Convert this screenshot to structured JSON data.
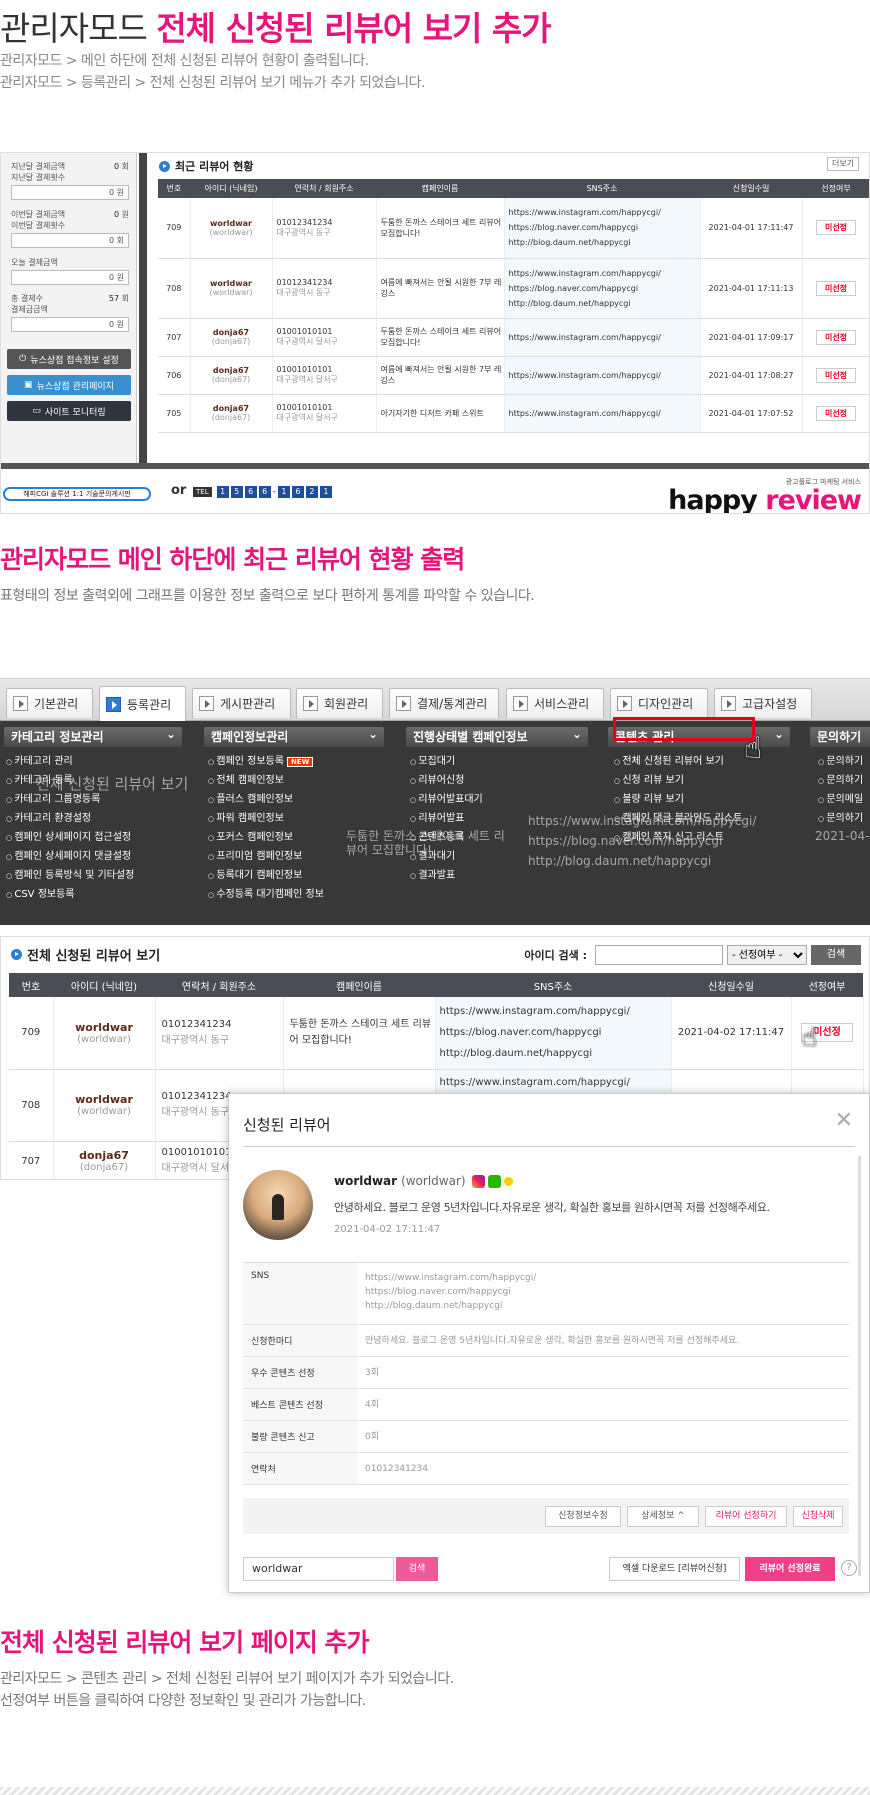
{
  "header": {
    "title_plain": "관리자모드",
    "title_highlight": "전체 신청된 리뷰어 보기 추가",
    "desc1": "관리자모드 > 메인 하단에 전체 신청된 리뷰어 현황이 출력됩니다.",
    "desc2": "관리자모드 > 등록관리 > 전체 신청된 리뷰어 보기 메뉴가 추가 되었습니다."
  },
  "shot1": {
    "stats": [
      {
        "label1": "지난달 결제금액",
        "val1": "0",
        "unit1": "회",
        "label2": "지난달 결제횟수",
        "box": "0",
        "boxunit": "원"
      },
      {
        "label1": "이번달 결제금액",
        "val1": "0",
        "unit1": "원",
        "label2": "이번달 결제횟수",
        "box": "0",
        "boxunit": "회"
      },
      {
        "label1": "오늘 결제금액",
        "val1": "",
        "unit1": "",
        "label2": "",
        "box": "0",
        "boxunit": "원"
      },
      {
        "label1": "총 결제수",
        "val1": "57",
        "unit1": "회",
        "label2": "결제금금액",
        "box": "0",
        "boxunit": "원"
      }
    ],
    "buttons": [
      "뉴스상점 접속정보 설정",
      "뉴스상점 관리페이지",
      "사이트 모니터링"
    ],
    "panel_title": "최근 리뷰어 현황",
    "more_label": "더보기",
    "columns": [
      "번호",
      "아이디 (닉네임)",
      "연락처 / 회원주소",
      "캠페인이름",
      "SNS주소",
      "신청일수일",
      "선정여부"
    ],
    "rows": [
      {
        "no": "709",
        "id": "worldwar",
        "nick": "(worldwar)",
        "phone": "01012341234",
        "addr": "대구광역시 동구",
        "campaign": "두툼한 돈까스 스테이크 세트 리뷰어 모집합니다!",
        "sns": [
          "https://www.instagram.com/happycgi/",
          "https://blog.naver.com/happycgi",
          "http://blog.daum.net/happycgi"
        ],
        "date": "2021-04-01 17:11:47",
        "status": "미선정"
      },
      {
        "no": "708",
        "id": "worldwar",
        "nick": "(worldwar)",
        "phone": "01012341234",
        "addr": "대구광역시 동구",
        "campaign": "여름에 빠져서는 안될 시원한 7부 레깅스",
        "sns": [
          "https://www.instagram.com/happycgi/",
          "https://blog.naver.com/happycgi",
          "http://blog.daum.net/happycgi"
        ],
        "date": "2021-04-01 17:11:13",
        "status": "미선정"
      },
      {
        "no": "707",
        "id": "donja67",
        "nick": "(donja67)",
        "phone": "01001010101",
        "addr": "대구광역시 달서구",
        "campaign": "두툼한 돈까스 스테이크 세트 리뷰어 모집합니다!",
        "sns": [
          "https://www.instagram.com/happycgi/"
        ],
        "date": "2021-04-01 17:09:17",
        "status": "미선정"
      },
      {
        "no": "706",
        "id": "donja67",
        "nick": "(donja67)",
        "phone": "01001010101",
        "addr": "대구광역시 달서구",
        "campaign": "여름에 빠져서는 안될 시원한 7부 레깅스",
        "sns": [
          "https://www.instagram.com/happycgi/"
        ],
        "date": "2021-04-01 17:08:27",
        "status": "미선정"
      },
      {
        "no": "705",
        "id": "donja67",
        "nick": "(donja67)",
        "phone": "01001010101",
        "addr": "대구광역시 달서구",
        "campaign": "아기자기한 디저트 카페 스위트",
        "sns": [
          "https://www.instagram.com/happycgi/"
        ],
        "date": "2021-04-01 17:07:52",
        "status": "미선정"
      }
    ],
    "footer": {
      "cgi_label": "해피CGI 솔루션 1:1 기술문의게시판",
      "or_label": "or",
      "tel_tag": "TEL",
      "tel_digits": [
        "1",
        "5",
        "6",
        "6",
        "-",
        "1",
        "6",
        "2",
        "1"
      ],
      "logo_small": "광고플로그 마케팅 서비스",
      "logo_happy": "happy",
      "logo_review": "review"
    }
  },
  "section2": {
    "title": "관리자모드 메인 하단에 최근 리뷰어 현황 출력",
    "desc": "표형태의 정보 출력외에 그래프를 이용한 정보 출력으로 보다 편하게 통계를 파악할 수 있습니다."
  },
  "shot2": {
    "tabs": [
      "기본관리",
      "등록관리",
      "게시판관리",
      "회원관리",
      "결제/통계관리",
      "서비스관리",
      "디자인관리",
      "고급자설정"
    ],
    "columns": [
      {
        "title": "카테고리 정보관리",
        "items": [
          "카테고리 관리",
          "카테고리 등록",
          "카테고리 그룹명등록",
          "카테고리 환경설정",
          "캠페인 상세페이지 접근설정",
          "캠페인 상세페이지 댓글설정",
          "캠페인 등록방식 및 기타설정",
          "CSV 정보등록"
        ]
      },
      {
        "title": "캠페인정보관리",
        "items": [
          "캠페인 정보등록",
          "전체 캠페인정보",
          "플러스 캠페인정보",
          "파워 캠페인정보",
          "포커스 캠페인정보",
          "프리미엄 캠페인정보",
          "등록대기 캠페인정보",
          "수정등록 대기캠페인 정보"
        ]
      },
      {
        "title": "진행상태별 캠페인정보",
        "items": [
          "모집대기",
          "리뷰어신청",
          "리뷰어발표대기",
          "리뷰어발표",
          "콘텐츠등록",
          "결과대기",
          "결과발표"
        ]
      },
      {
        "title": "콘텐츠 관리",
        "items": [
          "전체 신청된 리뷰어 보기",
          "신청 리뷰 보기",
          "불량 리뷰 보기",
          "캠페인 댓글 블라인드 리스트",
          "캠페인 쪽지 신고 리스트"
        ]
      },
      {
        "title": "문의하기",
        "items": [
          "문의하기",
          "문의하기",
          "문의메일",
          "문의하기"
        ]
      }
    ],
    "new_badge": "NEW"
  },
  "shot3": {
    "title": "전체 신청된 리뷰어 보기",
    "search_label": "아이디 검색 :",
    "select_value": "- 선정여부 -",
    "search_btn": "검색",
    "columns": [
      "번호",
      "아이디 (닉네임)",
      "연락처 / 회원주소",
      "캠페인이름",
      "SNS주소",
      "신청일수일",
      "선정여부"
    ],
    "rows": [
      {
        "no": "709",
        "id": "worldwar",
        "nick": "(worldwar)",
        "phone": "01012341234",
        "addr": "대구광역시 동구",
        "campaign": "두툼한 돈까스 스테이크 세트 리뷰어 모집합니다!",
        "sns": [
          "https://www.instagram.com/happycgi/",
          "https://blog.naver.com/happycgi",
          "http://blog.daum.net/happycgi"
        ],
        "date": "2021-04-02 17:11:47",
        "status": "미선정"
      },
      {
        "no": "708",
        "id": "worldwar",
        "nick": "(worldwar)",
        "phone": "01012341234",
        "addr": "대구광역시 동구",
        "campaign": "",
        "sns": [
          "https://www.instagram.com/happycgi/"
        ],
        "date": "",
        "status": ""
      },
      {
        "no": "707",
        "id": "donja67",
        "nick": "(donja67)",
        "phone": "01001010101",
        "addr": "대구광역시 달서구",
        "campaign": "",
        "sns": [],
        "date": "",
        "status": ""
      }
    ]
  },
  "modal": {
    "title": "신청된 리뷰어",
    "user_id": "worldwar",
    "user_nick": "(worldwar)",
    "intro": "안녕하세요. 블로그 운영 5년차입니다.자유로운 생각, 확실한 홍보를 원하시면꼭 저를 선정해주세요.",
    "date": "2021-04-02 17:11:47",
    "fields": [
      {
        "key": "SNS",
        "values": [
          "https://www.instagram.com/happycgi/",
          "https://blog.naver.com/happycgi",
          "http://blog.daum.net/happycgi"
        ]
      },
      {
        "key": "신청한마디",
        "values": [
          "안녕하세요. 블로그 운영 5년차입니다.자유로운 생각, 확실한 홍보를 원하시면꼭 저를 선정해주세요."
        ]
      },
      {
        "key": "우수 콘텐츠 선정",
        "values": [
          "3회"
        ]
      },
      {
        "key": "베스트 콘텐츠 선정",
        "values": [
          "4회"
        ]
      },
      {
        "key": "불량 콘텐츠 신고",
        "values": [
          "0회"
        ]
      },
      {
        "key": "연락처",
        "values": [
          "01012341234"
        ]
      }
    ],
    "actions": [
      "신청정보수정",
      "상세정보 ^",
      "리뷰어 선정하기",
      "신청삭제"
    ],
    "search_value": "worldwar",
    "search_btn": "검색",
    "excel_btn": "엑셀 다운로드 [리뷰어신청]",
    "done_btn": "리뷰어 선정완료",
    "help": "?"
  },
  "section3": {
    "title": "전체 신청된 리뷰어 보기 페이지 추가",
    "desc1": "관리자모드 > 콘텐츠 관리 > 전체 신청된 리뷰어 보기 페이지가 추가 되었습니다.",
    "desc2": "선정여부 버튼을 클릭하여 다양한 정보확인 및 관리가 가능합니다."
  },
  "colors": {
    "accent_pink": "#e5157a",
    "table_head": "#4a4d55",
    "unselected_red": "#e3001b",
    "brand_blue": "#2a7fd4"
  }
}
